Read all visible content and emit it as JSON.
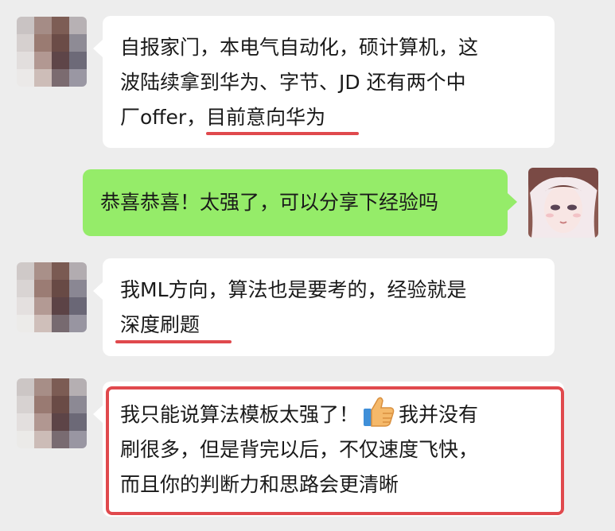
{
  "messages": [
    {
      "side": "left",
      "lines": [
        "自报家门，本电气自动化，硕计算机，这",
        "波陆续拿到华为、字节、JD 还有两个中",
        "厂offer，目前意向华为"
      ]
    },
    {
      "side": "right",
      "lines": [
        "恭喜恭喜！太强了，可以分享下经验吗"
      ]
    },
    {
      "side": "left",
      "lines": [
        "我ML方向，算法也是要考的，经验就是",
        "深度刷题"
      ]
    },
    {
      "side": "left",
      "lines_before_icon": "我只能说算法模板太强了！",
      "icon": "thumbs-up-icon",
      "lines_after_icon": "我并没有",
      "lines": [
        "刷很多，但是背完以后，不仅速度飞快，",
        "而且你的判断力和思路会更清晰"
      ]
    }
  ],
  "colors": {
    "background": "#ededed",
    "left_bubble": "#ffffff",
    "right_bubble": "#95ec69",
    "highlight": "#e0494d"
  }
}
